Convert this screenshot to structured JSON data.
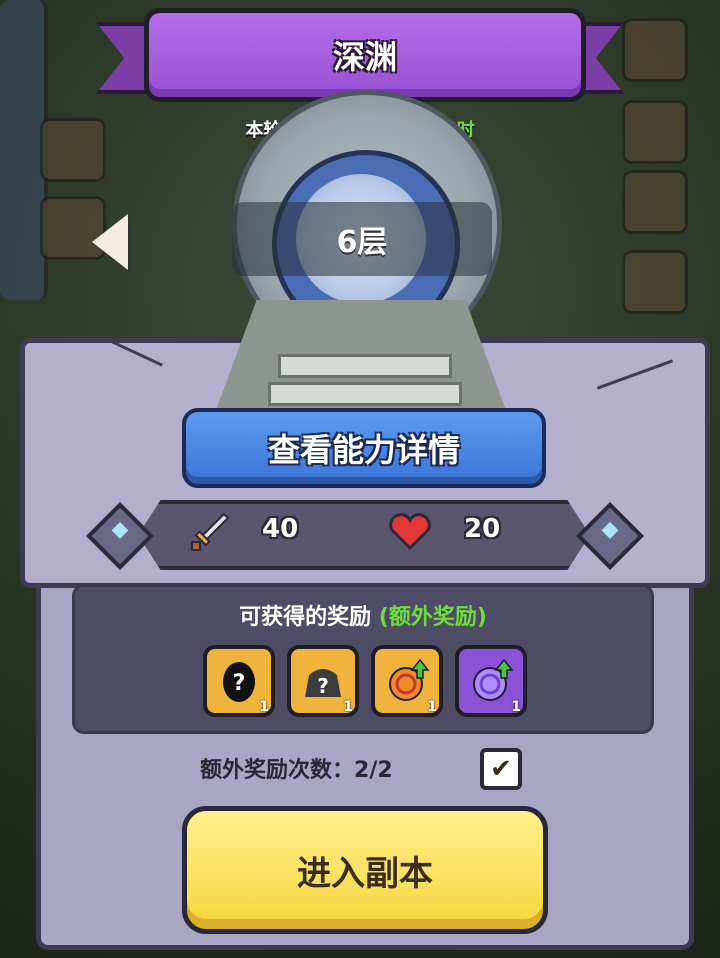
{
  "title": "深渊",
  "timer": {
    "label": "本轮挑战剩余时间",
    "value": "2天6小时"
  },
  "floor": "6层",
  "details_button": "查看能力详情",
  "stats": {
    "attack": "40",
    "health": "20"
  },
  "rewards": {
    "title": "可获得的奖励",
    "extra": "(额外奖励)",
    "items": [
      {
        "icon": "mystery-egg-icon",
        "count": "1"
      },
      {
        "icon": "mystery-pouch-icon",
        "count": "1"
      },
      {
        "icon": "orange-orb-upgrade-icon",
        "count": "1"
      },
      {
        "icon": "purple-orb-upgrade-icon",
        "count": "1"
      }
    ]
  },
  "extra_count": {
    "label": "额外奖励次数：",
    "value": "2/2"
  },
  "enter_button": "进入副本",
  "colors": {
    "title_purple": "#9a4fd4",
    "green_text": "#6fdc3e",
    "blue_button": "#3d74d6",
    "yellow_button": "#f5d43e"
  }
}
